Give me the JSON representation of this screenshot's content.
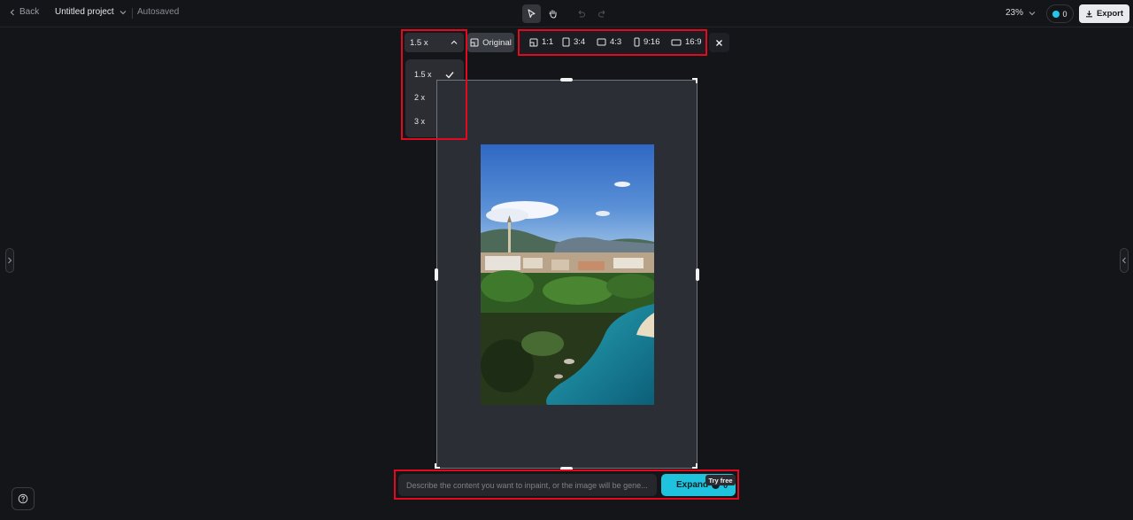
{
  "topbar": {
    "back_label": "Back",
    "project_title": "Untitled project",
    "autosave_status": "Autosaved",
    "zoom_level": "23%",
    "credits_count": "0",
    "export_label": "Export"
  },
  "expand_toolbar": {
    "scale_selected": "1.5 x",
    "original_label": "Original",
    "ratios": [
      "1:1",
      "3:4",
      "4:3",
      "9:16",
      "16:9"
    ]
  },
  "scale_dropdown": {
    "options": [
      "1.5 x",
      "2 x",
      "3 x"
    ],
    "selected_index": 0
  },
  "prompt": {
    "placeholder": "Describe the content you want to inpaint, or the image will be gene...",
    "value": ""
  },
  "expand_button": {
    "label": "Expand",
    "credit_cost": "0",
    "badge": "Try free"
  },
  "colors": {
    "background": "#141519",
    "accent": "#1fc3dd",
    "highlight": "#e3091e"
  },
  "icons": [
    "chevron-left-icon",
    "chevron-down-icon",
    "pointer-icon",
    "hand-icon",
    "undo-icon",
    "redo-icon",
    "export-icon",
    "original-icon",
    "close-icon",
    "check-icon",
    "help-icon"
  ]
}
